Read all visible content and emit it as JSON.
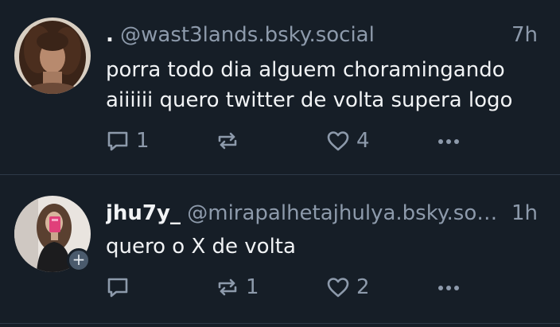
{
  "colors": {
    "background": "#161e27",
    "text": "#f1f3f5",
    "muted": "#8d9aab",
    "divider": "#2e3a48"
  },
  "posts": [
    {
      "display_name": ".",
      "handle": "@wast3lands.bsky.social",
      "time": "7h",
      "text": "porra todo dia alguem choramingando aiiiiii quero twitter de volta supera logo",
      "reply_count": "1",
      "repost_count": "",
      "like_count": "4",
      "icons": [
        "reply-icon",
        "repost-icon",
        "like-icon",
        "more-icon"
      ]
    },
    {
      "display_name": "jhu7y_",
      "handle": "@mirapalhetajhulya.bsky.so…",
      "time": "1h",
      "text": "quero o X de volta",
      "reply_count": "",
      "repost_count": "1",
      "like_count": "2",
      "follow_badge": "+",
      "icons": [
        "reply-icon",
        "repost-icon",
        "like-icon",
        "more-icon"
      ]
    }
  ]
}
